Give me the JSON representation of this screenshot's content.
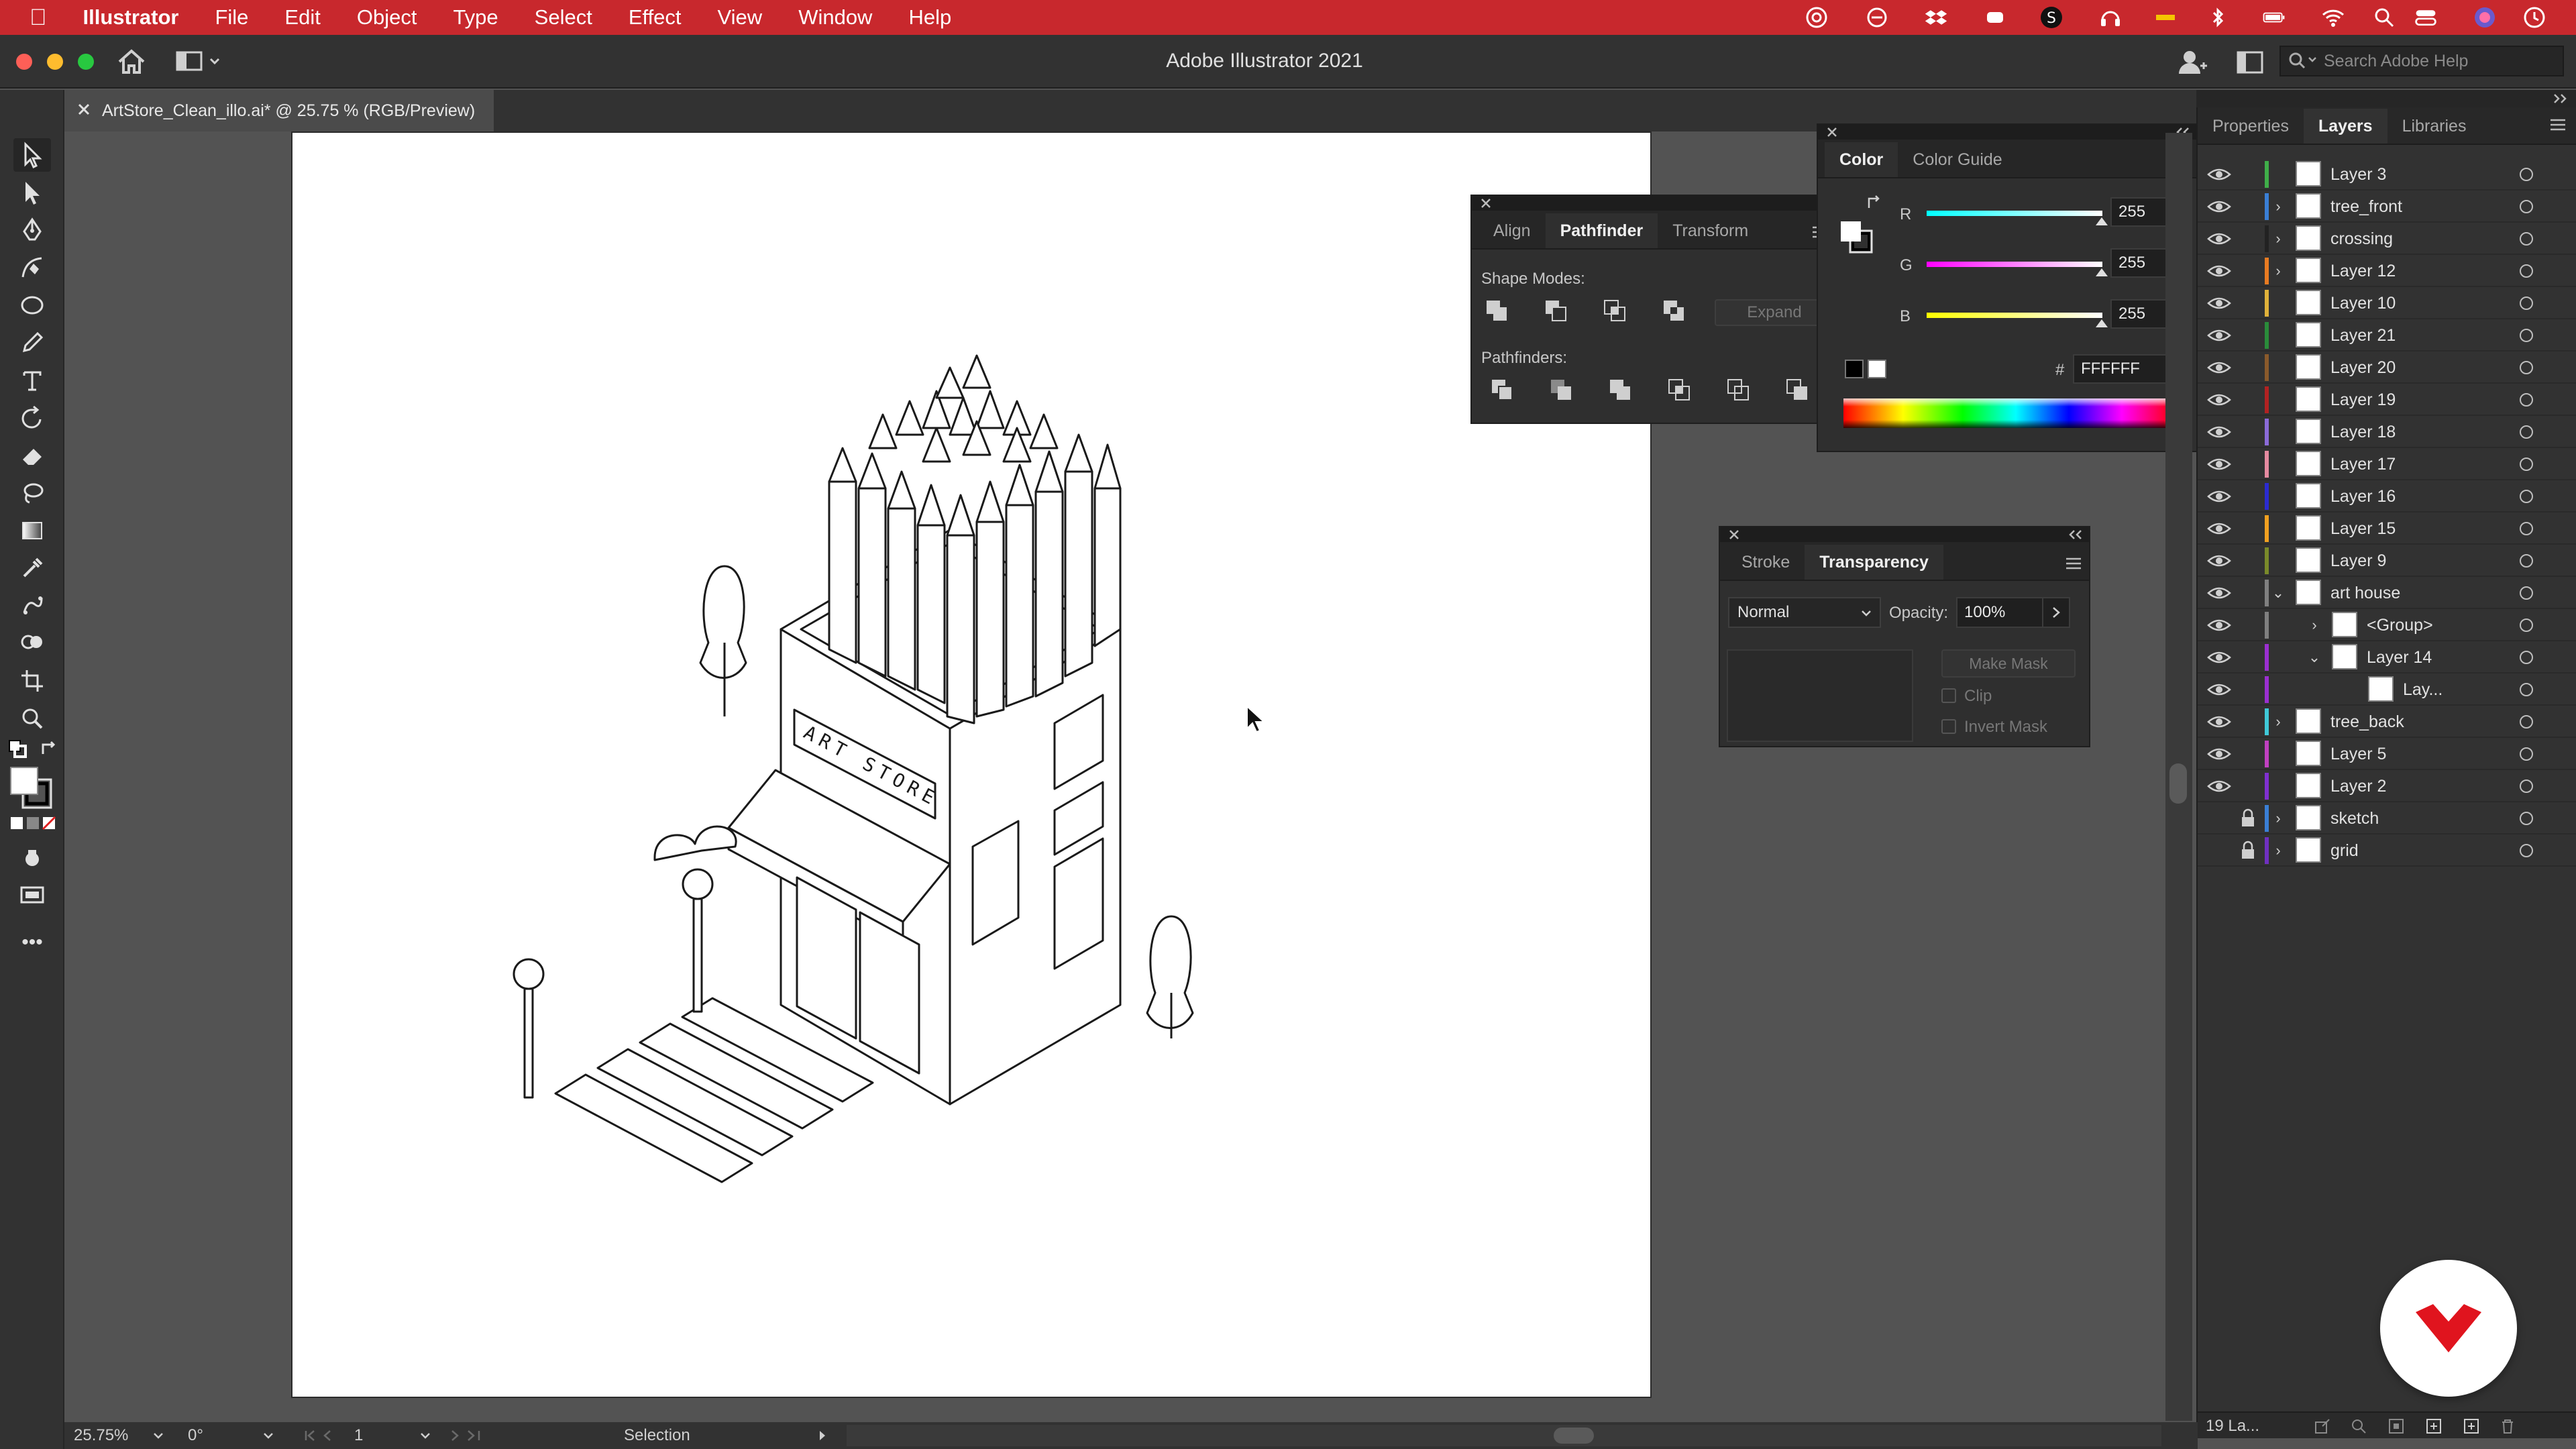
{
  "menubar": {
    "items": [
      "Illustrator",
      "File",
      "Edit",
      "Object",
      "Type",
      "Select",
      "Effect",
      "View",
      "Window",
      "Help"
    ],
    "bg_color": "#c8282d"
  },
  "appbar": {
    "title": "Adobe Illustrator 2021",
    "search_placeholder": "Search Adobe Help"
  },
  "document": {
    "tab_title": "ArtStore_Clean_illo.ai* @ 25.75 % (RGB/Preview)",
    "store_sign": "ART STORE"
  },
  "color_panel": {
    "tabs": [
      "Color",
      "Color Guide"
    ],
    "r_label": "R",
    "r_value": "255",
    "g_label": "G",
    "g_value": "255",
    "b_label": "B",
    "b_value": "255",
    "hex_prefix": "#",
    "hex_value": "FFFFFF"
  },
  "pathfinder_panel": {
    "tabs": [
      "Align",
      "Pathfinder",
      "Transform"
    ],
    "shape_modes_label": "Shape Modes:",
    "expand_label": "Expand",
    "pathfinders_label": "Pathfinders:"
  },
  "transparency_panel": {
    "tabs": [
      "Stroke",
      "Transparency"
    ],
    "blend_mode": "Normal",
    "opacity_label": "Opacity:",
    "opacity_value": "100%",
    "make_mask_label": "Make Mask",
    "clip_label": "Clip",
    "invert_mask_label": "Invert Mask"
  },
  "layers_panel": {
    "tabs": [
      "Properties",
      "Layers",
      "Libraries"
    ],
    "rows": [
      {
        "name": "Layer 3",
        "color": "#3fae49"
      },
      {
        "name": "tree_front",
        "color": "#3a7fd5",
        "expandable": true
      },
      {
        "name": "crossing",
        "color": "#222222",
        "expandable": true
      },
      {
        "name": "Layer 12",
        "color": "#e87b22",
        "expandable": true
      },
      {
        "name": "Layer 10",
        "color": "#e0b23a"
      },
      {
        "name": "Layer 21",
        "color": "#2a8c3a"
      },
      {
        "name": "Layer 20",
        "color": "#8a5a2b"
      },
      {
        "name": "Layer 19",
        "color": "#b22222"
      },
      {
        "name": "Layer 18",
        "color": "#8b6bd8"
      },
      {
        "name": "Layer 17",
        "color": "#e58aa0"
      },
      {
        "name": "Layer 16",
        "color": "#2b2bd0"
      },
      {
        "name": "Layer 15",
        "color": "#f0a020"
      },
      {
        "name": "Layer 9",
        "color": "#7a8a2a"
      },
      {
        "name": "art house",
        "color": "#808080",
        "expanded": true
      },
      {
        "name": "<Group>",
        "color": "#808080",
        "expandable": true
      },
      {
        "name": "Layer 14",
        "color": "#9b2fd0",
        "expanded": true
      },
      {
        "name": "Lay...",
        "color": "#9b2fd0"
      },
      {
        "name": "tree_back",
        "color": "#3fc9d8",
        "expandable": true
      },
      {
        "name": "Layer 5",
        "color": "#c040c0"
      },
      {
        "name": "Layer 2",
        "color": "#8030d0"
      },
      {
        "name": "sketch",
        "color": "#3a7fd5",
        "expandable": true,
        "locked": true
      },
      {
        "name": "grid",
        "color": "#7030c0",
        "expandable": true,
        "locked": true
      }
    ],
    "count_label": "19 La..."
  },
  "statusbar": {
    "zoom": "25.75%",
    "rotation": "0°",
    "artboard_number": "1",
    "tool_name": "Selection"
  }
}
